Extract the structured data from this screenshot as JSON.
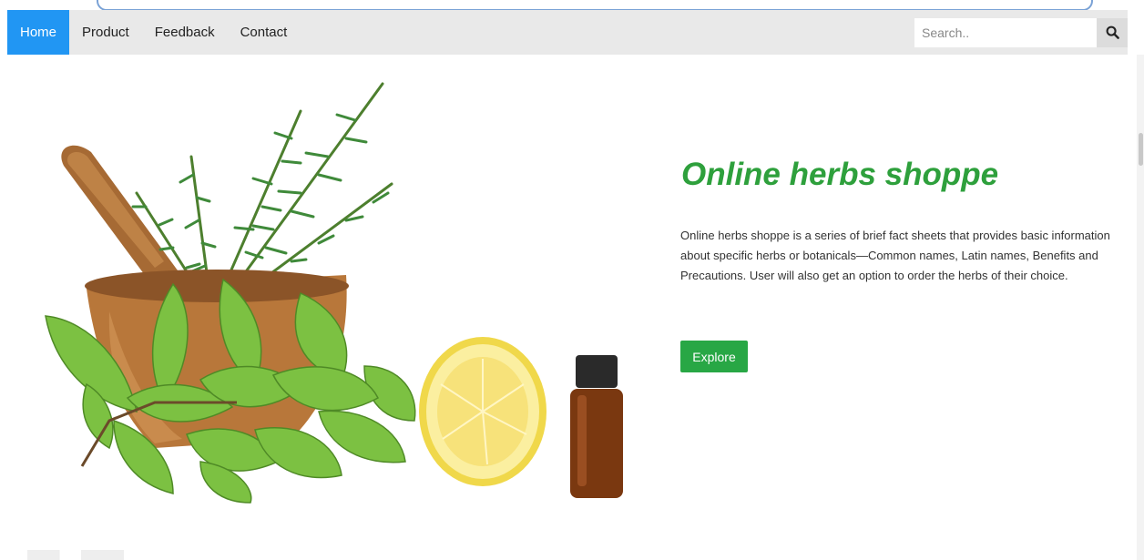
{
  "nav": {
    "items": [
      {
        "label": "Home",
        "active": true
      },
      {
        "label": "Product",
        "active": false
      },
      {
        "label": "Feedback",
        "active": false
      },
      {
        "label": "Contact",
        "active": false
      }
    ]
  },
  "search": {
    "placeholder": "Search..",
    "icon": "search-icon"
  },
  "hero": {
    "title": "Online herbs shoppe",
    "description": "Online herbs shoppe is a series of brief fact sheets that provides basic information about specific herbs or botanicals—Common names, Latin names, Benefits and Precautions. User will also get an option to order the herbs of their choice.",
    "button_label": "Explore"
  },
  "colors": {
    "nav_active": "#2196F3",
    "title_green": "#2ea03c",
    "button_green": "#28a745",
    "nav_bg": "#e9e9e9"
  }
}
